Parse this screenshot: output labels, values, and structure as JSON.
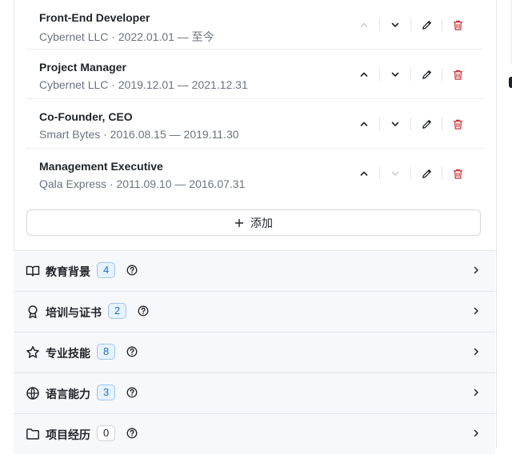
{
  "experience": {
    "items": [
      {
        "title": "Front-End Developer",
        "subtitle": "Cybernet LLC · 2022.01.01 — 至今"
      },
      {
        "title": "Project Manager",
        "subtitle": "Cybernet LLC · 2019.12.01 — 2021.12.31"
      },
      {
        "title": "Co-Founder, CEO",
        "subtitle": "Smart Bytes · 2016.08.15 — 2019.11.30"
      },
      {
        "title": "Management Executive",
        "subtitle": "Qala Express · 2011.09.10 — 2016.07.31"
      }
    ],
    "add_label": "添加"
  },
  "sections": [
    {
      "label": "教育背景",
      "count": "4",
      "icon": "book-open-icon"
    },
    {
      "label": "培训与证书",
      "count": "2",
      "icon": "award-icon"
    },
    {
      "label": "专业技能",
      "count": "8",
      "icon": "star-icon"
    },
    {
      "label": "语言能力",
      "count": "3",
      "icon": "globe-icon"
    },
    {
      "label": "项目经历",
      "count": "0",
      "icon": "folder-icon"
    }
  ],
  "colors": {
    "accent_blue": "#1f6fbf",
    "delete_red": "#d13438",
    "muted_text": "#6b7280"
  }
}
